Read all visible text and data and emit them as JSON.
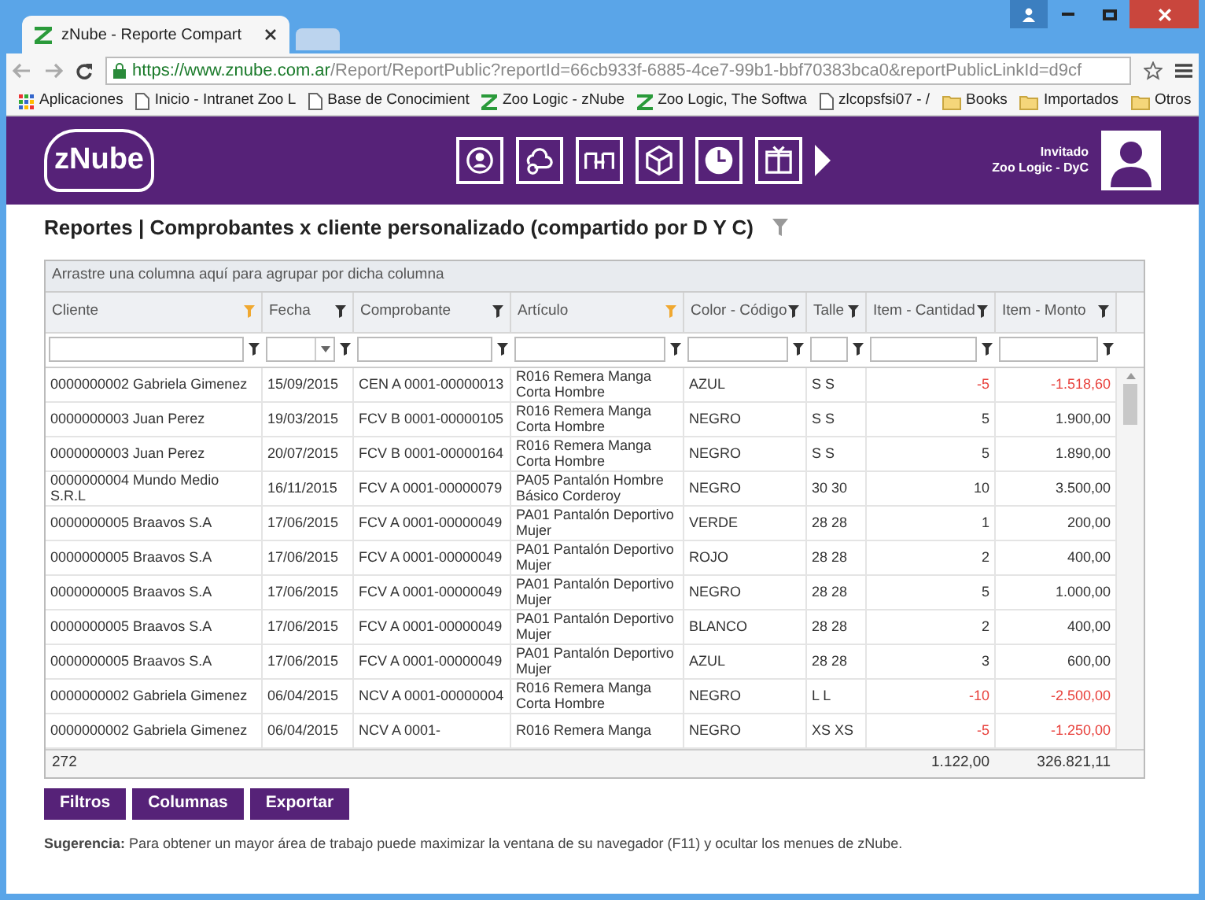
{
  "browser": {
    "tab_title": "zNube - Reporte Compart",
    "url_host": "https://www.znube.com.ar",
    "url_path": "/Report/ReportPublic?reportId=66cb933f-6885-4ce7-99b1-bbf70383bca0&reportPublicLinkId=d9cf",
    "bookmarks": [
      {
        "label": "Aplicaciones",
        "kind": "apps"
      },
      {
        "label": "Inicio - Intranet Zoo L",
        "kind": "page"
      },
      {
        "label": "Base de Conocimient",
        "kind": "page"
      },
      {
        "label": "Zoo Logic - zNube",
        "kind": "z"
      },
      {
        "label": "Zoo Logic, The Softwa",
        "kind": "z"
      },
      {
        "label": "zlcopsfsi07 - /",
        "kind": "page"
      },
      {
        "label": "Books",
        "kind": "folder"
      },
      {
        "label": "Importados",
        "kind": "folder"
      },
      {
        "label": "Otros",
        "kind": "folder"
      }
    ]
  },
  "header": {
    "logo": "zNube",
    "user_name": "Invitado",
    "user_org": "Zoo Logic - DyC"
  },
  "page_title": "Reportes | Comprobantes x cliente personalizado (compartido por D Y C)",
  "grid": {
    "group_hint": "Arrastre una columna aquí para agrupar por dicha columna",
    "columns": [
      {
        "label": "Cliente",
        "filtered": true,
        "kind": "text"
      },
      {
        "label": "Fecha",
        "filtered": false,
        "kind": "date"
      },
      {
        "label": "Comprobante",
        "filtered": false,
        "kind": "text"
      },
      {
        "label": "Artículo",
        "filtered": true,
        "kind": "text"
      },
      {
        "label": "Color - Código",
        "filtered": false,
        "kind": "text"
      },
      {
        "label": "Talle",
        "filtered": false,
        "kind": "text"
      },
      {
        "label": "Item - Cantidad",
        "filtered": false,
        "kind": "number"
      },
      {
        "label": "Item - Monto",
        "filtered": false,
        "kind": "number"
      }
    ],
    "rows": [
      {
        "cells": [
          "0000000002 Gabriela Gimenez",
          "15/09/2015",
          "CEN A 0001-00000013",
          "R016 Remera Manga Corta Hombre",
          "AZUL",
          "S S",
          "-5",
          "-1.518,60"
        ],
        "negative": true
      },
      {
        "cells": [
          "0000000003 Juan Perez",
          "19/03/2015",
          "FCV B 0001-00000105",
          "R016 Remera Manga Corta Hombre",
          "NEGRO",
          "S S",
          "5",
          "1.900,00"
        ],
        "negative": false
      },
      {
        "cells": [
          "0000000003 Juan Perez",
          "20/07/2015",
          "FCV B 0001-00000164",
          "R016 Remera Manga Corta Hombre",
          "NEGRO",
          "S S",
          "5",
          "1.890,00"
        ],
        "negative": false
      },
      {
        "cells": [
          "0000000004 Mundo Medio S.R.L",
          "16/11/2015",
          "FCV A 0001-00000079",
          "PA05 Pantalón Hombre Básico Corderoy",
          "NEGRO",
          "30 30",
          "10",
          "3.500,00"
        ],
        "negative": false
      },
      {
        "cells": [
          "0000000005 Braavos S.A",
          "17/06/2015",
          "FCV A 0001-00000049",
          "PA01 Pantalón Deportivo Mujer",
          "VERDE",
          "28 28",
          "1",
          "200,00"
        ],
        "negative": false
      },
      {
        "cells": [
          "0000000005 Braavos S.A",
          "17/06/2015",
          "FCV A 0001-00000049",
          "PA01 Pantalón Deportivo Mujer",
          "ROJO",
          "28 28",
          "2",
          "400,00"
        ],
        "negative": false
      },
      {
        "cells": [
          "0000000005 Braavos S.A",
          "17/06/2015",
          "FCV A 0001-00000049",
          "PA01 Pantalón Deportivo Mujer",
          "NEGRO",
          "28 28",
          "5",
          "1.000,00"
        ],
        "negative": false
      },
      {
        "cells": [
          "0000000005 Braavos S.A",
          "17/06/2015",
          "FCV A 0001-00000049",
          "PA01 Pantalón Deportivo Mujer",
          "BLANCO",
          "28 28",
          "2",
          "400,00"
        ],
        "negative": false
      },
      {
        "cells": [
          "0000000005 Braavos S.A",
          "17/06/2015",
          "FCV A 0001-00000049",
          "PA01 Pantalón Deportivo Mujer",
          "AZUL",
          "28 28",
          "3",
          "600,00"
        ],
        "negative": false
      },
      {
        "cells": [
          "0000000002 Gabriela Gimenez",
          "06/04/2015",
          "NCV A 0001-00000004",
          "R016 Remera Manga Corta Hombre",
          "NEGRO",
          "L L",
          "-10",
          "-2.500,00"
        ],
        "negative": true
      },
      {
        "cells": [
          "0000000002 Gabriela Gimenez",
          "06/04/2015",
          "NCV A 0001-",
          "R016 Remera Manga",
          "NEGRO",
          "XS XS",
          "-5",
          "-1.250,00"
        ],
        "negative": true
      }
    ],
    "footer": {
      "count": "272",
      "total_cantidad": "1.122,00",
      "total_monto": "326.821,11"
    }
  },
  "buttons": [
    "Filtros",
    "Columnas",
    "Exportar"
  ],
  "hint": "**Sugerencia:** Para obtener un mayor área de trabajo puede maximizar la ventana de su navegador (F11) y ocultar los menues de zNube."
}
